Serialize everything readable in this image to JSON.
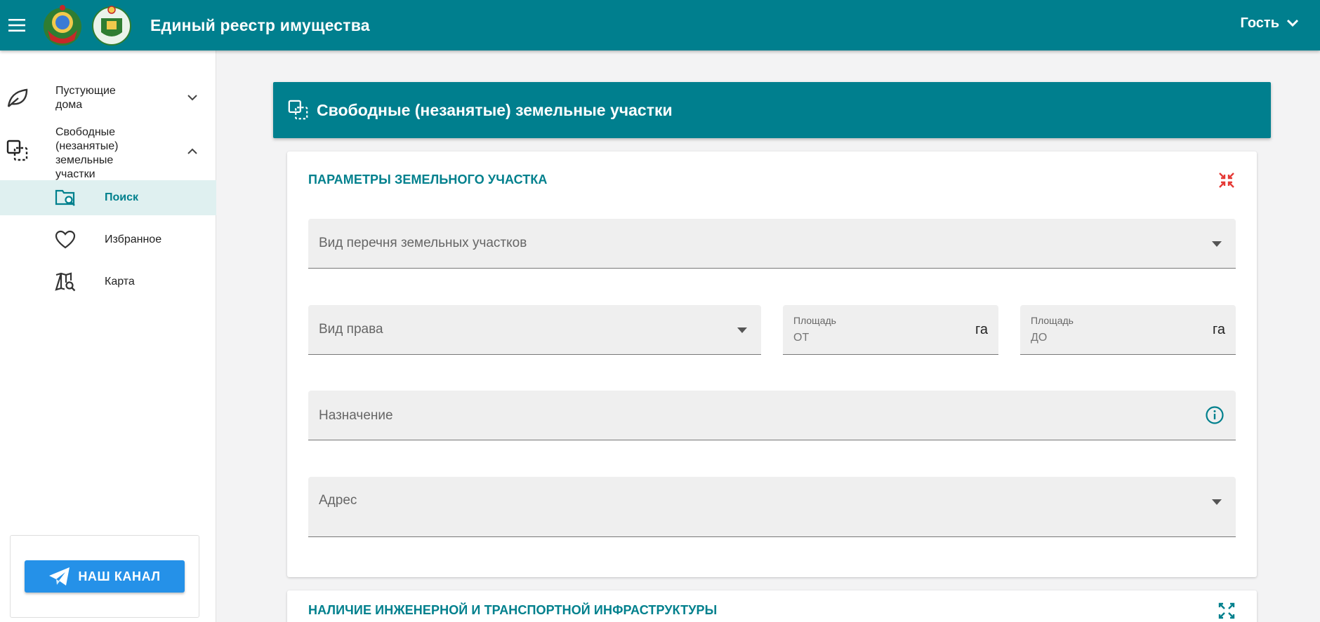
{
  "header": {
    "title": "Единый реестр имущества",
    "user_label": "Гость"
  },
  "sidebar": {
    "groups": [
      {
        "label": "Пустующие дома",
        "icon": "leaf-icon",
        "expanded": false
      },
      {
        "label": "Свободные (незанятые) земельные участки",
        "icon": "land-plots-icon",
        "expanded": true
      }
    ],
    "items": [
      {
        "label": "Поиск",
        "icon": "folder-search-icon",
        "active": true
      },
      {
        "label": "Избранное",
        "icon": "heart-icon",
        "active": false
      },
      {
        "label": "Карта",
        "icon": "map-search-icon",
        "active": false
      }
    ],
    "channel_button": "НАШ КАНАЛ"
  },
  "main": {
    "panel_title": "Свободные (незанятые) земельные участки",
    "section1": {
      "title": "ПАРАМЕТРЫ ЗЕМЕЛЬНОГО УЧАСТКА",
      "fields": {
        "list_type": {
          "label": "Вид перечня земельных участков",
          "value": ""
        },
        "right_type": {
          "label": "Вид права",
          "value": ""
        },
        "area_from": {
          "label": "Площадь",
          "placeholder": "ОТ",
          "unit": "га"
        },
        "area_to": {
          "label": "Площадь",
          "placeholder": "ДО",
          "unit": "га"
        },
        "purpose": {
          "label": "Назначение",
          "value": ""
        },
        "address": {
          "label": "Адрес",
          "value": ""
        }
      }
    },
    "section2": {
      "title": "НАЛИЧИЕ ИНЖЕНЕРНОЙ И ТРАНСПОРТНОЙ ИНФРАСТРУКТУРЫ"
    }
  },
  "colors": {
    "primary": "#007f8e",
    "accent_text": "#00808d",
    "active_bg": "#dff0f0",
    "channel_button": "#2591e8",
    "collapse_icon": "#e53935"
  }
}
